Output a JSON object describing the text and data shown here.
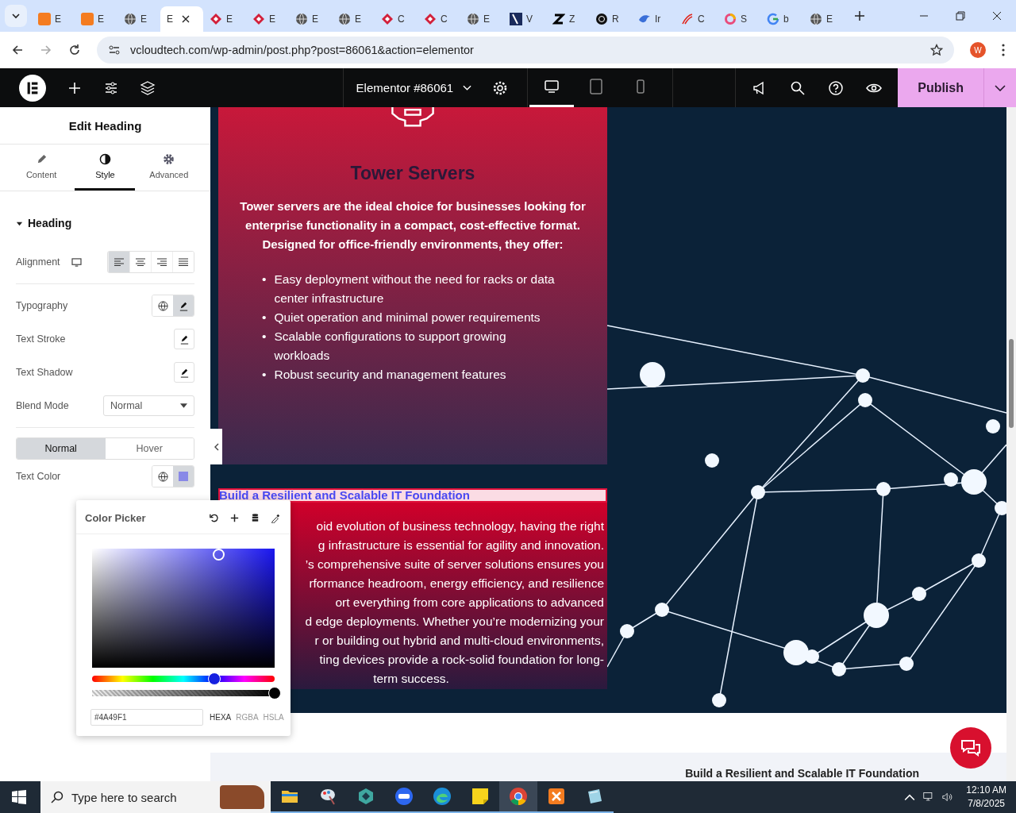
{
  "browser": {
    "tabs": [
      {
        "label": "E",
        "kind": "xampp",
        "selected": false
      },
      {
        "label": "E",
        "kind": "xampp",
        "selected": false
      },
      {
        "label": "E",
        "kind": "globe",
        "selected": false
      },
      {
        "label": "E",
        "kind": "blank",
        "selected": true
      },
      {
        "label": "E",
        "kind": "diamond",
        "selected": false
      },
      {
        "label": "E",
        "kind": "diamond",
        "selected": false
      },
      {
        "label": "E",
        "kind": "globe",
        "selected": false
      },
      {
        "label": "E",
        "kind": "globe",
        "selected": false
      },
      {
        "label": "C",
        "kind": "diamond",
        "selected": false
      },
      {
        "label": "C",
        "kind": "diamond",
        "selected": false
      },
      {
        "label": "E",
        "kind": "globe",
        "selected": false
      },
      {
        "label": "V",
        "kind": "navy",
        "selected": false
      },
      {
        "label": "Z",
        "kind": "zigzag",
        "selected": false
      },
      {
        "label": "R",
        "kind": "circle",
        "selected": false
      },
      {
        "label": "Ir",
        "kind": "bird",
        "selected": false
      },
      {
        "label": "C",
        "kind": "swoosh",
        "selected": false
      },
      {
        "label": "S",
        "kind": "ring",
        "selected": false
      },
      {
        "label": "b",
        "kind": "g",
        "selected": false
      },
      {
        "label": "E",
        "kind": "globe",
        "selected": false
      }
    ],
    "url": "vcloudtech.com/wp-admin/post.php?post=86061&action=elementor",
    "profile": "W"
  },
  "topbar": {
    "title": "Elementor #86061",
    "devices": [
      {
        "kind": "desktop",
        "selected": true
      },
      {
        "kind": "tablet",
        "selected": false
      },
      {
        "kind": "mobile",
        "selected": false
      }
    ],
    "publish": "Publish"
  },
  "panel": {
    "title": "Edit Heading",
    "tabs": [
      {
        "label": "Content",
        "kind": "pencil",
        "selected": false
      },
      {
        "label": "Style",
        "kind": "contrast",
        "selected": true
      },
      {
        "label": "Advanced",
        "kind": "gear",
        "selected": false
      }
    ],
    "section": {
      "title": "Heading",
      "expanded": true
    },
    "alignment": {
      "label": "Alignment",
      "options": [
        {
          "kind": "left",
          "selected": true
        },
        {
          "kind": "center",
          "selected": false
        },
        {
          "kind": "right",
          "selected": false
        },
        {
          "kind": "justify",
          "selected": false
        }
      ]
    },
    "typography": "Typography",
    "text_stroke": "Text Stroke",
    "text_shadow": "Text Shadow",
    "blend_mode": {
      "label": "Blend Mode",
      "value": "Normal"
    },
    "states": [
      {
        "label": "Normal",
        "selected": true
      },
      {
        "label": "Hover",
        "selected": false
      }
    ],
    "text_color": "Text Color"
  },
  "color_picker": {
    "title": "Color Picker",
    "value": "#4A49F1",
    "hue_slider": {
      "level": 0.67
    },
    "alpha_slider": {
      "level": 1
    },
    "formats": [
      {
        "label": "HEXA",
        "selected": true
      },
      {
        "label": "RGBA",
        "selected": false
      },
      {
        "label": "HSLA",
        "selected": false
      }
    ]
  },
  "canvas": {
    "card_title": "Tower Servers",
    "card_intro": "Tower servers are the ideal choice for businesses looking for enterprise functionality in a compact, cost-effective format. Designed for office-friendly environments, they offer:",
    "bullets": [
      {
        "marker": "•",
        "text": "Easy deployment without the need for racks or data center infrastructure"
      },
      {
        "marker": "•",
        "text": "Quiet operation and minimal power requirements"
      },
      {
        "marker": "•",
        "text": "Scalable configurations to support growing workloads"
      },
      {
        "marker": "•",
        "text": "Robust security and management features"
      }
    ],
    "heading": "Build a Resilient and Scalable IT Foundation",
    "paragraph_lines": [
      "oid evolution of business technology, having the right",
      "g infrastructure is essential for agility and innovation.",
      "’s comprehensive suite of server solutions ensures you",
      "rformance headroom, energy efficiency, and resilience",
      "ort everything from core applications to advanced",
      "d edge deployments. Whether you’re modernizing your",
      "r or building out hybrid and multi-cloud environments,",
      "ting devices provide a rock-solid foundation for long-",
      "term success."
    ],
    "footer_heading": "Build a Resilient and Scalable IT Foundation"
  },
  "taskbar": {
    "search": "Type here to search",
    "apps": [
      {
        "kind": "folder",
        "selected": false
      },
      {
        "kind": "paint",
        "selected": false
      },
      {
        "kind": "hex",
        "selected": false
      },
      {
        "kind": "zoom",
        "selected": false
      },
      {
        "kind": "edge",
        "selected": false
      },
      {
        "kind": "note",
        "selected": false
      },
      {
        "kind": "chrome",
        "selected": true
      },
      {
        "kind": "xampp",
        "selected": false
      },
      {
        "kind": "files",
        "selected": false
      }
    ],
    "time": "12:10 AM",
    "date": "7/8/2025"
  }
}
